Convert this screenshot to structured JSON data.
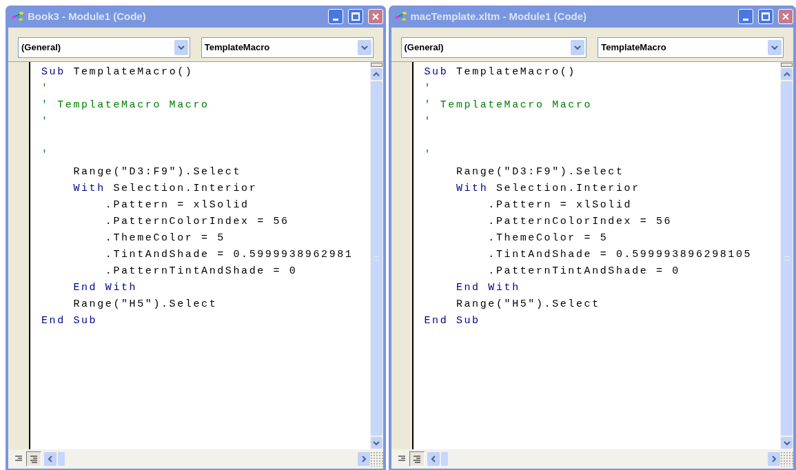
{
  "windows": [
    {
      "title": "Book3 - Module1 (Code)",
      "object_combo": "(General)",
      "procedure_combo": "TemplateMacro",
      "view_buttons": [
        {
          "selected": false
        },
        {
          "selected": true
        }
      ],
      "lines": [
        {
          "tokens": [
            {
              "kind": "keyword",
              "text": "Sub"
            },
            {
              "kind": "plain",
              "text": " TemplateMacro()"
            }
          ]
        },
        {
          "tokens": [
            {
              "kind": "comment",
              "text": "'"
            }
          ]
        },
        {
          "tokens": [
            {
              "kind": "comment",
              "text": "' TemplateMacro Macro"
            }
          ]
        },
        {
          "tokens": [
            {
              "kind": "comment",
              "text": "'"
            }
          ]
        },
        {
          "kind": "blank"
        },
        {
          "tokens": [
            {
              "kind": "comment",
              "text": "'"
            }
          ]
        },
        {
          "tokens": [
            {
              "kind": "plain",
              "text": "    Range(\"D3:F9\").Select"
            }
          ]
        },
        {
          "tokens": [
            {
              "kind": "keyword",
              "text": "    With"
            },
            {
              "kind": "plain",
              "text": " Selection.Interior"
            }
          ]
        },
        {
          "tokens": [
            {
              "kind": "plain",
              "text": "        .Pattern = xlSolid"
            }
          ]
        },
        {
          "tokens": [
            {
              "kind": "plain",
              "text": "        .PatternColorIndex = 56"
            }
          ]
        },
        {
          "tokens": [
            {
              "kind": "plain",
              "text": "        .ThemeColor = 5"
            }
          ]
        },
        {
          "tokens": [
            {
              "kind": "plain",
              "text": "        .TintAndShade = 0.5999938962981"
            }
          ]
        },
        {
          "tokens": [
            {
              "kind": "plain",
              "text": "        .PatternTintAndShade = 0"
            }
          ]
        },
        {
          "tokens": [
            {
              "kind": "keyword",
              "text": "    End With"
            }
          ]
        },
        {
          "tokens": [
            {
              "kind": "plain",
              "text": "    Range(\"H5\").Select"
            }
          ]
        },
        {
          "tokens": [
            {
              "kind": "keyword",
              "text": "End Sub"
            }
          ]
        }
      ]
    },
    {
      "title": "macTemplate.xltm - Module1 (Code)",
      "object_combo": "(General)",
      "procedure_combo": "TemplateMacro",
      "view_buttons": [
        {
          "selected": false
        },
        {
          "selected": true
        }
      ],
      "lines": [
        {
          "tokens": [
            {
              "kind": "keyword",
              "text": "Sub"
            },
            {
              "kind": "plain",
              "text": " TemplateMacro()"
            }
          ]
        },
        {
          "tokens": [
            {
              "kind": "comment",
              "text": "'"
            }
          ]
        },
        {
          "tokens": [
            {
              "kind": "comment",
              "text": "' TemplateMacro Macro"
            }
          ]
        },
        {
          "tokens": [
            {
              "kind": "comment",
              "text": "'"
            }
          ]
        },
        {
          "kind": "blank"
        },
        {
          "tokens": [
            {
              "kind": "comment",
              "text": "'"
            }
          ]
        },
        {
          "tokens": [
            {
              "kind": "plain",
              "text": "    Range(\"D3:F9\").Select"
            }
          ]
        },
        {
          "tokens": [
            {
              "kind": "keyword",
              "text": "    With"
            },
            {
              "kind": "plain",
              "text": " Selection.Interior"
            }
          ]
        },
        {
          "tokens": [
            {
              "kind": "plain",
              "text": "        .Pattern = xlSolid"
            }
          ]
        },
        {
          "tokens": [
            {
              "kind": "plain",
              "text": "        .PatternColorIndex = 56"
            }
          ]
        },
        {
          "tokens": [
            {
              "kind": "plain",
              "text": "        .ThemeColor = 5"
            }
          ]
        },
        {
          "tokens": [
            {
              "kind": "plain",
              "text": "        .TintAndShade = 0.599993896298105"
            }
          ]
        },
        {
          "tokens": [
            {
              "kind": "plain",
              "text": "        .PatternTintAndShade = 0"
            }
          ]
        },
        {
          "tokens": [
            {
              "kind": "keyword",
              "text": "    End With"
            }
          ]
        },
        {
          "tokens": [
            {
              "kind": "plain",
              "text": "    Range(\"H5\").Select"
            }
          ]
        },
        {
          "tokens": [
            {
              "kind": "keyword",
              "text": "End Sub"
            }
          ]
        }
      ]
    }
  ]
}
